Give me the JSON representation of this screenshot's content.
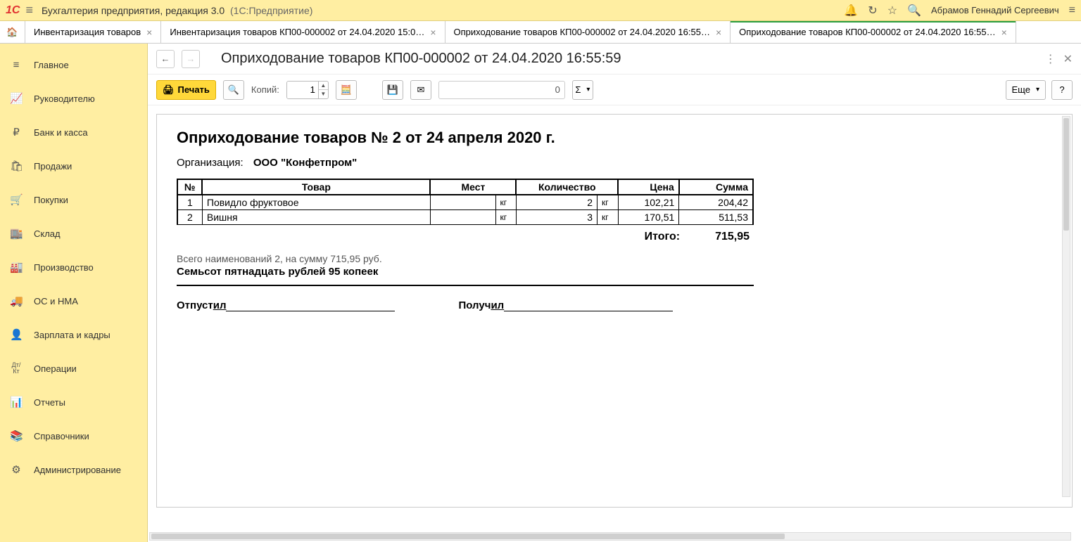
{
  "app": {
    "title": "Бухгалтерия предприятия, редакция 3.0",
    "subtitle": "(1С:Предприятие)",
    "user": "Абрамов Геннадий Сергеевич"
  },
  "tabs": [
    {
      "label": "Инвентаризация товаров",
      "active": false
    },
    {
      "label": "Инвентаризация товаров КП00-000002 от 24.04.2020 15:0…",
      "active": false
    },
    {
      "label": "Оприходование товаров КП00-000002 от 24.04.2020 16:55…",
      "active": false
    },
    {
      "label": "Оприходование товаров КП00-000002 от 24.04.2020 16:55…",
      "active": true
    }
  ],
  "sidebar": [
    {
      "icon": "≡",
      "label": "Главное"
    },
    {
      "icon": "📈",
      "label": "Руководителю"
    },
    {
      "icon": "₽",
      "label": "Банк и касса"
    },
    {
      "icon": "🛍",
      "label": "Продажи"
    },
    {
      "icon": "🛒",
      "label": "Покупки"
    },
    {
      "icon": "🏬",
      "label": "Склад"
    },
    {
      "icon": "🏭",
      "label": "Производство"
    },
    {
      "icon": "🚚",
      "label": "ОС и НМА"
    },
    {
      "icon": "👤",
      "label": "Зарплата и кадры"
    },
    {
      "icon": "Дт/Кт",
      "label": "Операции"
    },
    {
      "icon": "📊",
      "label": "Отчеты"
    },
    {
      "icon": "📚",
      "label": "Справочники"
    },
    {
      "icon": "⚙",
      "label": "Администрирование"
    }
  ],
  "page": {
    "title": "Оприходование товаров КП00-000002 от 24.04.2020 16:55:59"
  },
  "toolbar": {
    "print": "Печать",
    "copies_label": "Копий:",
    "copies_value": "1",
    "count_value": "0",
    "more": "Еще",
    "help": "?"
  },
  "document": {
    "title": "Оприходование товаров № 2 от 24 апреля 2020 г.",
    "org_label": "Организация:",
    "org_value": "ООО \"Конфетпром\"",
    "headers": {
      "num": "№",
      "tovar": "Товар",
      "mest": "Мест",
      "qty": "Количество",
      "price": "Цена",
      "sum": "Сумма"
    },
    "rows": [
      {
        "num": "1",
        "tovar": "Повидло фруктовое",
        "mest_unit": "кг",
        "qty": "2",
        "qty_unit": "кг",
        "price": "102,21",
        "sum": "204,42"
      },
      {
        "num": "2",
        "tovar": "Вишня",
        "mest_unit": "кг",
        "qty": "3",
        "qty_unit": "кг",
        "price": "170,51",
        "sum": "511,53"
      }
    ],
    "total_label": "Итого:",
    "total_value": "715,95",
    "summary1": "Всего наименований 2, на сумму 715,95 руб.",
    "summary2": "Семьсот пятнадцать рублей 95 копеек",
    "sign_out_prefix": "Отпуст",
    "sign_out_under": "ил",
    "sign_in_prefix": "Получ",
    "sign_in_under": "ил"
  }
}
